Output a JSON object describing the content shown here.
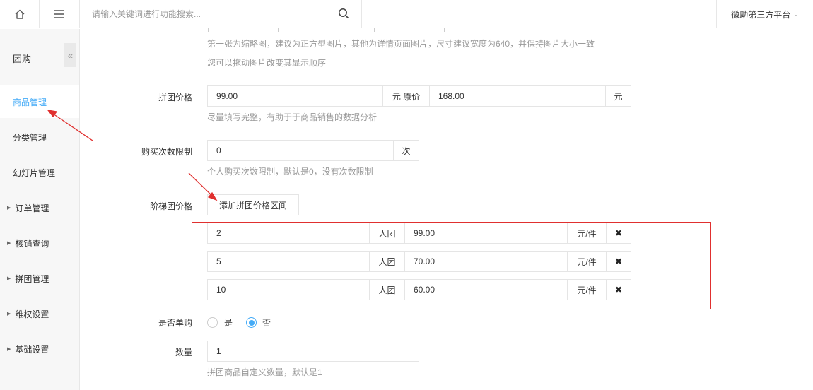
{
  "topbar": {
    "search_placeholder": "请输入关键词进行功能搜索...",
    "platform": "微助第三方平台"
  },
  "sidebar": {
    "title": "团购",
    "items": [
      {
        "label": "商品管理",
        "active": true
      },
      {
        "label": "分类管理"
      },
      {
        "label": "幻灯片管理"
      },
      {
        "label": "订单管理",
        "expandable": true
      },
      {
        "label": "核销查询",
        "expandable": true
      },
      {
        "label": "拼团管理",
        "expandable": true
      },
      {
        "label": "维权设置",
        "expandable": true
      },
      {
        "label": "基础设置",
        "expandable": true
      }
    ]
  },
  "form": {
    "image_help_1": "第一张为缩略图，建议为正方型图片，其他为详情页面图片，尺寸建议宽度为640，并保持图片大小一致",
    "image_help_2": "您可以拖动图片改变其显示顺序",
    "group_price": {
      "label": "拼团价格",
      "value": "99.00",
      "unit_orig": "元 原价",
      "orig_value": "168.00",
      "unit": "元",
      "help": "尽量填写完整，有助于于商品销售的数据分析"
    },
    "purchase_limit": {
      "label": "购买次数限制",
      "value": "0",
      "unit": "次",
      "help": "个人购买次数限制，默认是0，没有次数限制"
    },
    "tiered_price": {
      "label": "阶梯团价格",
      "add_button": "添加拼团价格区间",
      "rows": [
        {
          "people": "2",
          "people_unit": "人团",
          "price": "99.00",
          "price_unit": "元/件",
          "delete": "✖"
        },
        {
          "people": "5",
          "people_unit": "人团",
          "price": "70.00",
          "price_unit": "元/件",
          "delete": "✖"
        },
        {
          "people": "10",
          "people_unit": "人团",
          "price": "60.00",
          "price_unit": "元/件",
          "delete": "✖"
        }
      ]
    },
    "single_purchase": {
      "label": "是否单购",
      "options": [
        "是",
        "否"
      ],
      "selected": "否"
    },
    "quantity": {
      "label": "数量",
      "value": "1",
      "help": "拼团商品自定义数量，默认是1"
    }
  },
  "colors": {
    "accent": "#44abf7",
    "annotation_red": "#e0302f"
  }
}
